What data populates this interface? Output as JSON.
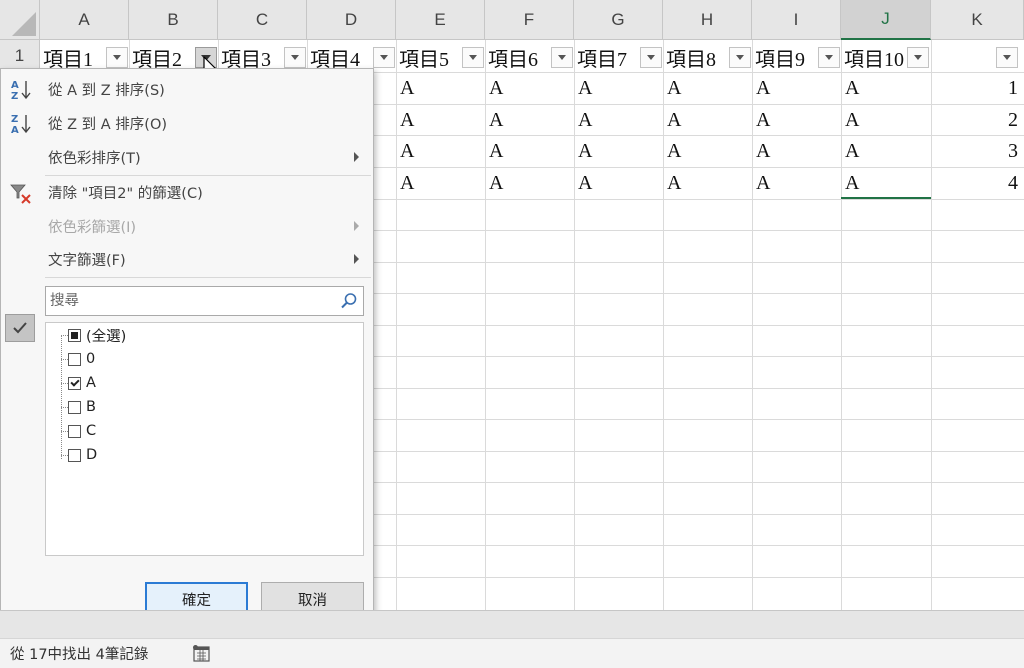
{
  "columns": [
    "A",
    "B",
    "C",
    "D",
    "E",
    "F",
    "G",
    "H",
    "I",
    "J",
    "K"
  ],
  "selected_column": "J",
  "row_numbers": [
    "1"
  ],
  "header_row": [
    "項目1",
    "項目2",
    "項目3",
    "項目4",
    "項目5",
    "項目6",
    "項目7",
    "項目8",
    "項目9",
    "項目10",
    ""
  ],
  "data_rows": [
    {
      "values": [
        "A",
        "A",
        "A",
        "A",
        "A",
        "A"
      ],
      "k": "1"
    },
    {
      "values": [
        "A",
        "A",
        "A",
        "A",
        "A",
        "A"
      ],
      "k": "2"
    },
    {
      "values": [
        "A",
        "A",
        "A",
        "A",
        "A",
        "A"
      ],
      "k": "3"
    },
    {
      "values": [
        "A",
        "A",
        "A",
        "A",
        "A",
        "A"
      ],
      "k": "4"
    }
  ],
  "filter_menu": {
    "sort_az": "從 A 到 Z 排序(S)",
    "sort_za": "從 Z 到 A 排序(O)",
    "sort_color": "依色彩排序(T)",
    "clear_filter": "清除 \"項目2\" 的篩選(C)",
    "filter_color": "依色彩篩選(I)",
    "text_filter": "文字篩選(F)",
    "search_placeholder": "搜尋",
    "list_items": [
      {
        "label": "(全選)",
        "state": "partial"
      },
      {
        "label": "0",
        "state": "unchecked"
      },
      {
        "label": "A",
        "state": "checked"
      },
      {
        "label": "B",
        "state": "unchecked"
      },
      {
        "label": "C",
        "state": "unchecked"
      },
      {
        "label": "D",
        "state": "unchecked"
      }
    ],
    "ok_label": "確定",
    "cancel_label": "取消"
  },
  "status": {
    "text": "從 17中找出 4筆記錄"
  },
  "colors": {
    "accent": "#217346",
    "ok_border": "#2b7bd4"
  }
}
